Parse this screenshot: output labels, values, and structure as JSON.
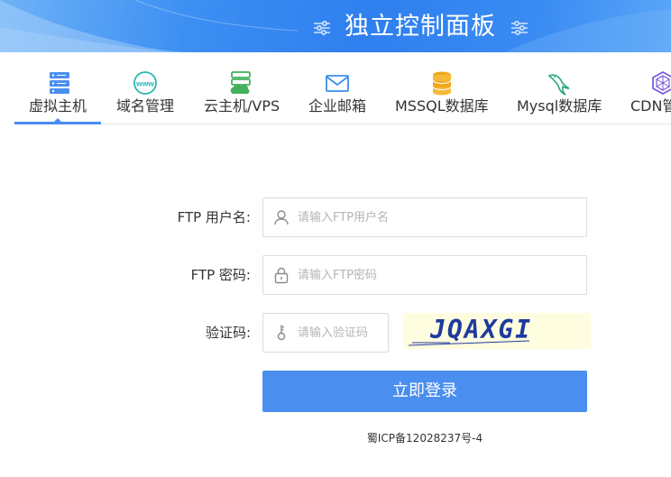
{
  "header": {
    "title": "独立控制面板",
    "left_icon": "sliders-icon",
    "right_icon": "sliders-icon"
  },
  "tabs": [
    {
      "label": "虚拟主机",
      "icon": "server-stack-icon",
      "active": true
    },
    {
      "label": "域名管理",
      "icon": "www-globe-icon",
      "active": false
    },
    {
      "label": "云主机/VPS",
      "icon": "cloud-server-icon",
      "active": false
    },
    {
      "label": "企业邮箱",
      "icon": "envelope-icon",
      "active": false
    },
    {
      "label": "MSSQL数据库",
      "icon": "database-icon",
      "active": false
    },
    {
      "label": "Mysql数据库",
      "icon": "mysql-dolphin-icon",
      "active": false
    },
    {
      "label": "CDN管",
      "icon": "cdn-network-icon",
      "active": false
    }
  ],
  "form": {
    "username": {
      "label": "FTP 用户名:",
      "placeholder": "请输入FTP用户名",
      "value": "",
      "icon": "user-icon"
    },
    "password": {
      "label": "FTP 密码:",
      "placeholder": "请输入FTP密码",
      "value": "",
      "icon": "lock-icon"
    },
    "captcha": {
      "label": "验证码:",
      "placeholder": "请输入验证码",
      "value": "",
      "icon": "key-icon",
      "image_text": "JQAXGI"
    },
    "submit_label": "立即登录"
  },
  "footer": {
    "icp": "蜀ICP备12028237号-4"
  },
  "colors": {
    "accent": "#4a8ff0",
    "header_gradient_mid": "#2f7fef",
    "captcha_bg": "#fffde0"
  }
}
